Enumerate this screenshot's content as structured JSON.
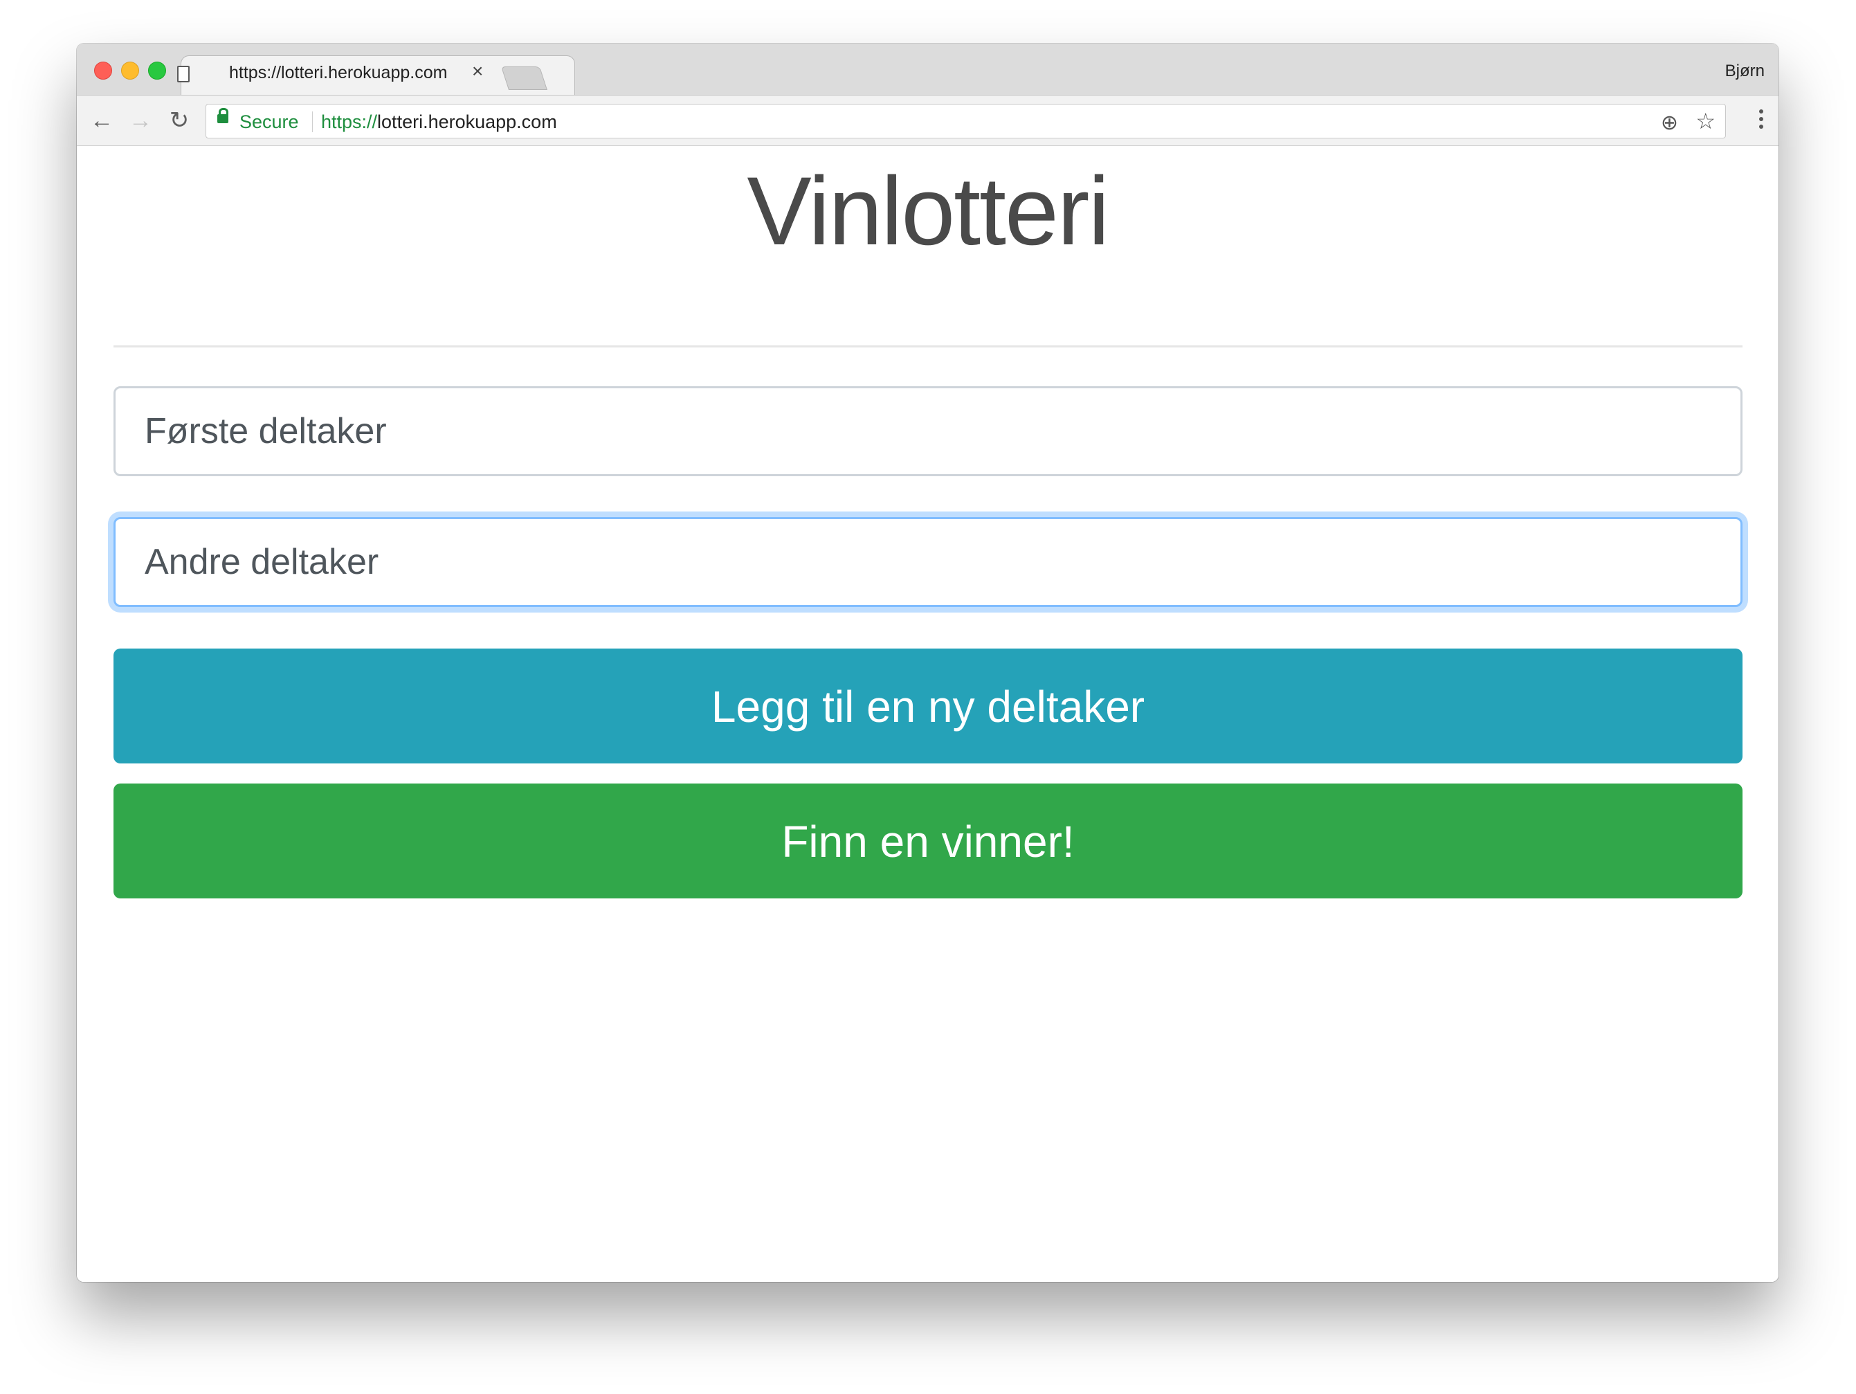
{
  "browser": {
    "tab_title": "https://lotteri.herokuapp.com",
    "tab_close_glyph": "×",
    "profile_name": "Bjørn",
    "secure_label": "Secure",
    "url_scheme": "https://",
    "url_rest": "lotteri.herokuapp.com",
    "icons": {
      "back": "←",
      "forward": "→",
      "reload": "↻",
      "zoom": "⊕",
      "star": "☆"
    }
  },
  "page": {
    "title": "Vinlotteri",
    "first_participant_placeholder": "Første deltaker",
    "second_participant_placeholder": "Andre deltaker",
    "add_participant_label": "Legg til en ny deltaker",
    "find_winner_label": "Finn en vinner!"
  },
  "colors": {
    "add_button": "#25a2b8",
    "winner_button": "#31a74a",
    "focus_ring": "#80bdff",
    "secure_green": "#1e8e3e"
  }
}
